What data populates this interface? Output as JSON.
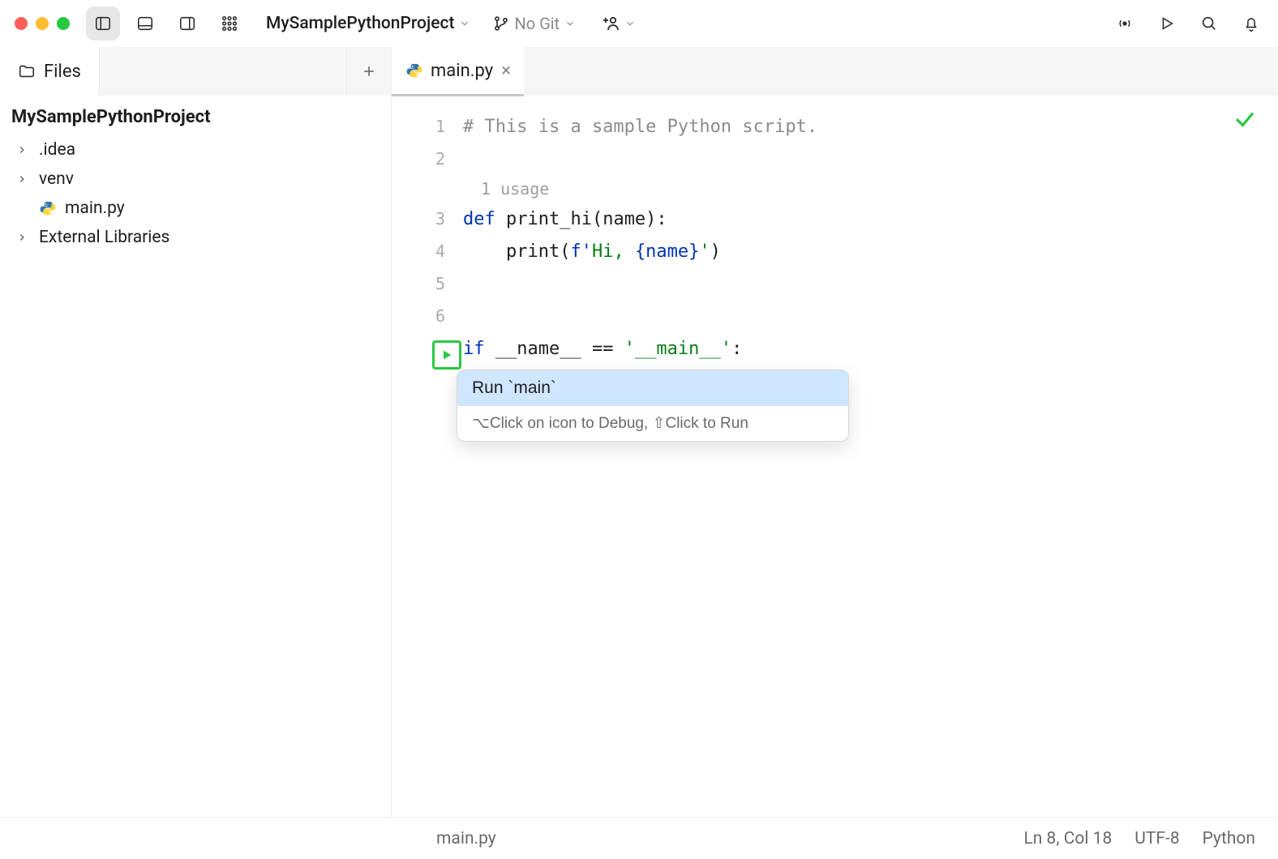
{
  "titlebar": {
    "project_name": "MySamplePythonProject",
    "vcs_label": "No Git"
  },
  "sidebar": {
    "tool_tab_label": "Files",
    "root_name": "MySamplePythonProject",
    "items": [
      {
        "label": ".idea",
        "kind": "folder"
      },
      {
        "label": "venv",
        "kind": "folder"
      },
      {
        "label": "main.py",
        "kind": "python"
      },
      {
        "label": "External Libraries",
        "kind": "folder"
      }
    ]
  },
  "editor": {
    "tab_filename": "main.py",
    "inlay_usage": "1 usage",
    "lines": {
      "l1_comment": "# This is a sample Python script.",
      "l3_def": "def",
      "l3_sig": " print_hi(name):",
      "l4_pre": "    print(",
      "l4_fpref": "f'",
      "l4_str": "Hi, ",
      "l4_fmt": "{name}",
      "l4_close": "'",
      "l4_paren": ")",
      "l7_if": "if",
      "l7_main": " __name__ == ",
      "l7_lit": "'__main__'",
      "l7_colon": ":"
    },
    "gutter_numbers": [
      "1",
      "2",
      "3",
      "4",
      "5",
      "6"
    ],
    "context_menu": {
      "primary": "Run `main`",
      "hint": "⌥Click on icon to Debug, ⇧Click to Run"
    }
  },
  "statusbar": {
    "breadcrumb": "main.py",
    "pos": "Ln 8, Col 18",
    "encoding": "UTF-8",
    "language": "Python"
  }
}
